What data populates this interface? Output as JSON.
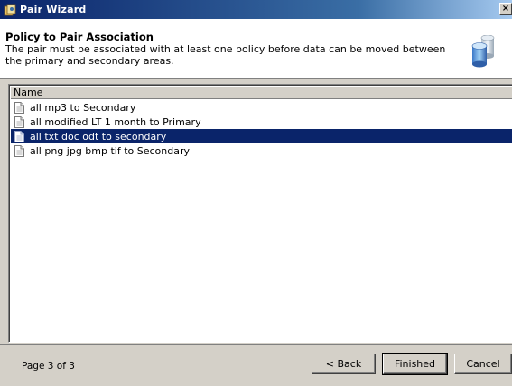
{
  "window": {
    "title": "Pair Wizard",
    "close_glyph": "×"
  },
  "header": {
    "title": "Policy to Pair Association",
    "description": "The pair must be associated with at least one policy before data can be moved between the primary and secondary areas."
  },
  "list": {
    "column_header": "Name",
    "selected_index": 2,
    "items": [
      {
        "label": "all mp3 to Secondary"
      },
      {
        "label": "all modified LT 1 month to Primary"
      },
      {
        "label": "all txt doc odt to secondary"
      },
      {
        "label": "all png jpg bmp tif to Secondary"
      }
    ]
  },
  "footer": {
    "page_label": "Page 3 of 3",
    "back_label": "< Back",
    "finished_label": "Finished",
    "cancel_label": "Cancel"
  },
  "colors": {
    "selection": "#0a246a",
    "dialog_face": "#d4d0c8"
  },
  "icons": {
    "window": "wizard-app-icon",
    "header": "database-icon",
    "item": "document-icon"
  }
}
